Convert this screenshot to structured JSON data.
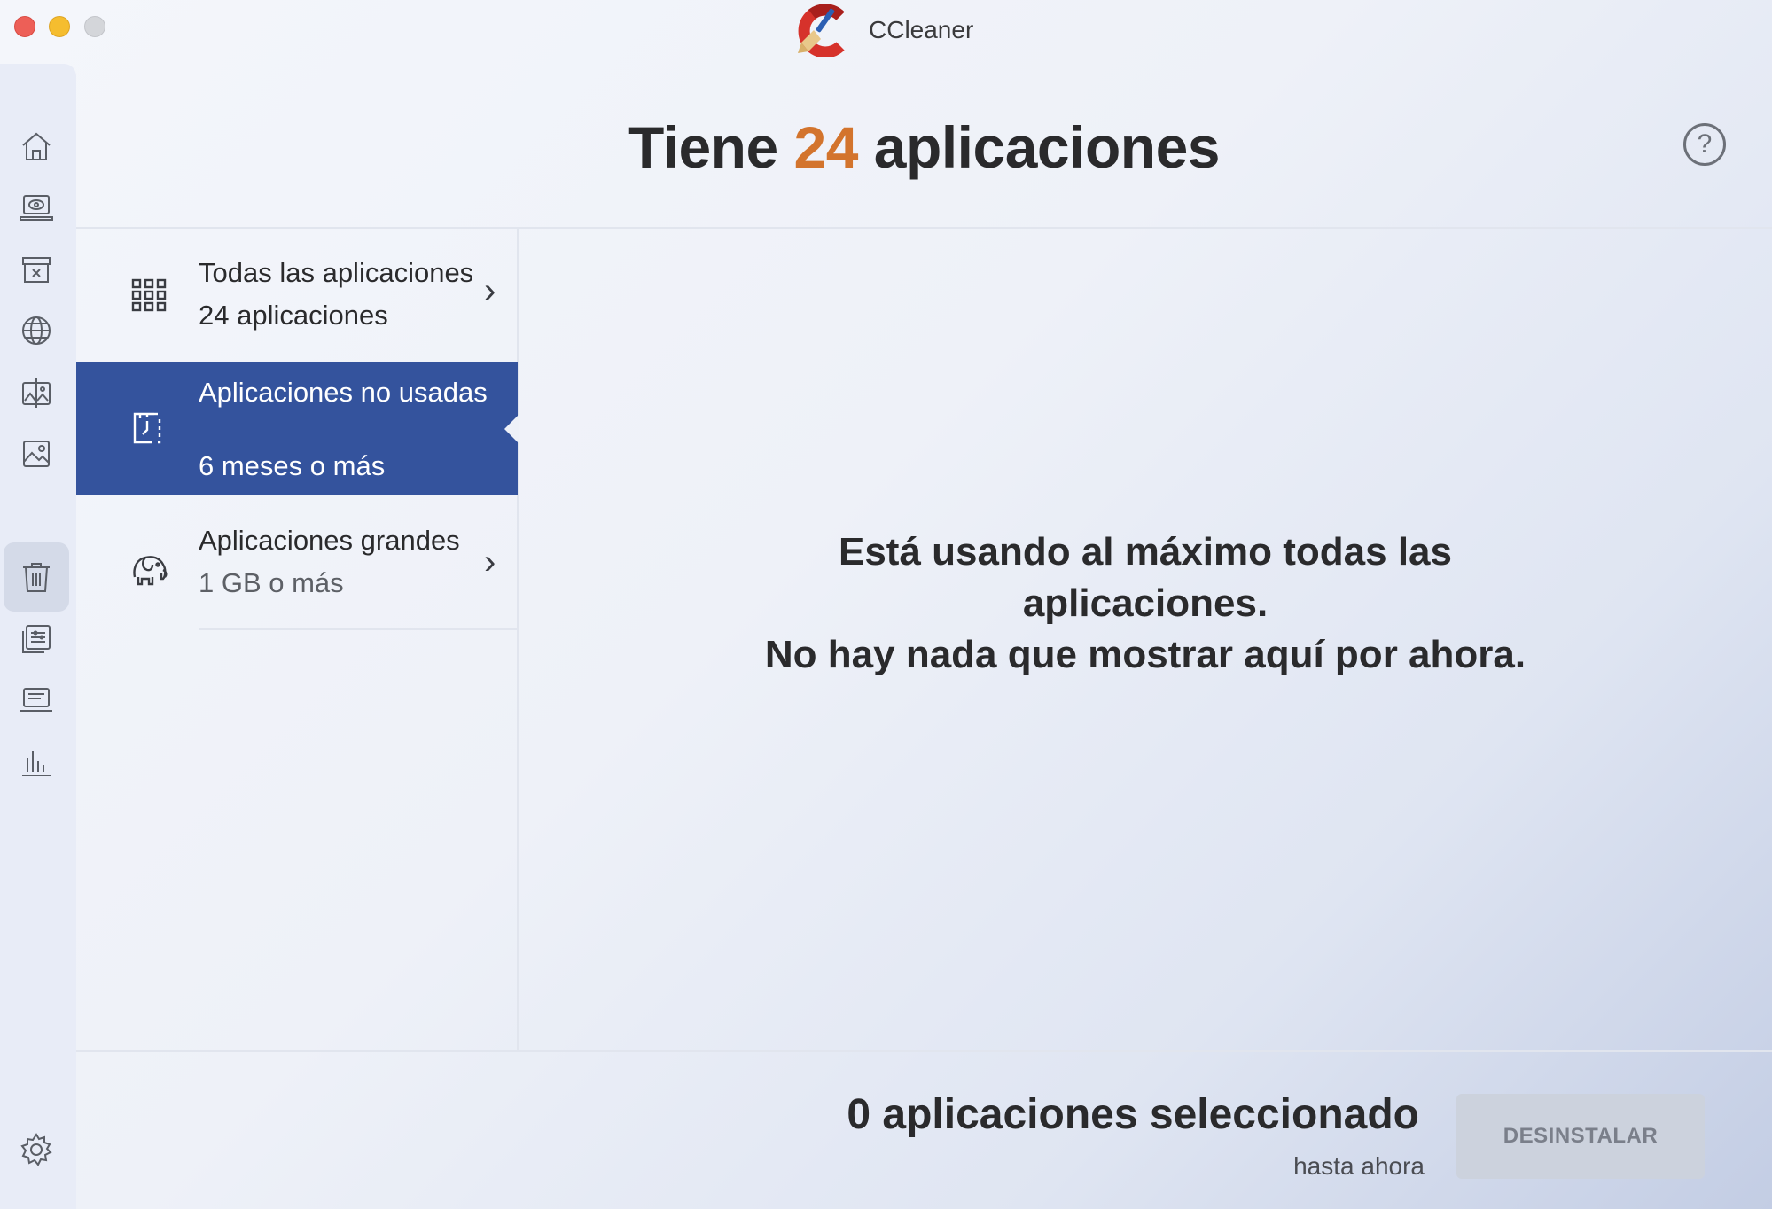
{
  "window": {
    "title": "CCleaner"
  },
  "header": {
    "title_prefix": "Tiene",
    "app_count": "24",
    "title_suffix": "aplicaciones",
    "help_label": "?"
  },
  "sidebar": {
    "items": [
      {
        "icon": "home-icon"
      },
      {
        "icon": "health-check-icon"
      },
      {
        "icon": "cleaner-icon"
      },
      {
        "icon": "browser-icon"
      },
      {
        "icon": "duplicate-finder-icon"
      },
      {
        "icon": "photo-icon"
      },
      {
        "icon": "uninstaller-icon",
        "active": true
      },
      {
        "icon": "optimizer-icon"
      },
      {
        "icon": "disk-icon"
      },
      {
        "icon": "stats-icon"
      }
    ],
    "settings_icon": "gear-icon"
  },
  "categories": [
    {
      "icon": "grid-icon",
      "title": "Todas las aplicaciones",
      "subtitle": "24 aplicaciones"
    },
    {
      "icon": "unused-apps-icon",
      "title": "Aplicaciones no usadas",
      "subtitle": "6 meses o más",
      "selected": true
    },
    {
      "icon": "elephant-icon",
      "title": "Aplicaciones grandes",
      "subtitle": "1 GB o más"
    }
  ],
  "empty_state": {
    "line1": "Está usando al máximo todas las",
    "line2": "aplicaciones.",
    "line3": "No hay nada que mostrar aquí por ahora."
  },
  "footer": {
    "selected_label": "0 aplicaciones seleccionado",
    "selected_sub": "hasta ahora",
    "uninstall_label": "DESINSTALAR"
  },
  "colors": {
    "accent_orange": "#d3742d",
    "selected_blue": "#34539d",
    "button_disabled": "#ccd2dd"
  }
}
